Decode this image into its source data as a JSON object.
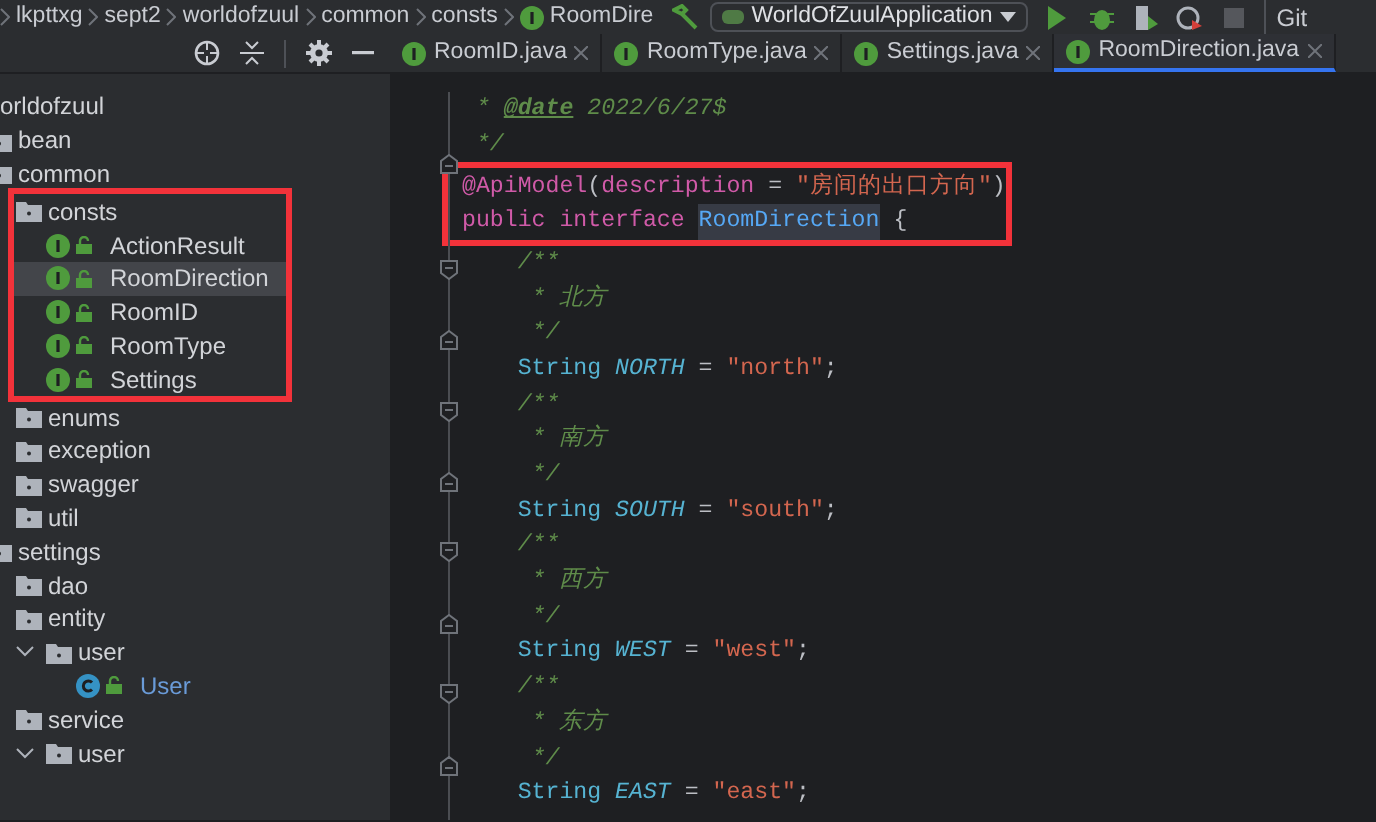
{
  "breadcrumbs": [
    {
      "label": "lkpttxg",
      "kind": "folder"
    },
    {
      "label": "sept2",
      "kind": "folder"
    },
    {
      "label": "worldofzuul",
      "kind": "folder"
    },
    {
      "label": "common",
      "kind": "folder"
    },
    {
      "label": "consts",
      "kind": "folder"
    },
    {
      "label": "RoomDire",
      "kind": "interface"
    }
  ],
  "run_config": {
    "label": "WorldOfZuulApplication"
  },
  "vcs_label": "Git",
  "tabs": [
    {
      "label": "RoomID.java",
      "selected": false
    },
    {
      "label": "RoomType.java",
      "selected": false
    },
    {
      "label": "Settings.java",
      "selected": false
    },
    {
      "label": "RoomDirection.java",
      "selected": true
    }
  ],
  "project_tree": [
    {
      "label": "orldofzuul",
      "children": [
        {
          "label": "bean",
          "kind": "folder"
        },
        {
          "label": "common",
          "kind": "folder",
          "children": [
            {
              "label": "consts",
              "kind": "folder",
              "boxed": true,
              "children": [
                {
                  "label": "ActionResult",
                  "kind": "interface",
                  "selected": false,
                  "modified": false
                },
                {
                  "label": "RoomDirection",
                  "kind": "interface",
                  "selected": true,
                  "modified": false
                },
                {
                  "label": "RoomID",
                  "kind": "interface",
                  "selected": false,
                  "modified": false
                },
                {
                  "label": "RoomType",
                  "kind": "interface",
                  "selected": false,
                  "modified": false
                },
                {
                  "label": "Settings",
                  "kind": "interface",
                  "selected": false,
                  "modified": false
                }
              ]
            },
            {
              "label": "enums",
              "kind": "folder"
            },
            {
              "label": "exception",
              "kind": "folder"
            },
            {
              "label": "swagger",
              "kind": "folder"
            },
            {
              "label": "util",
              "kind": "folder"
            }
          ]
        },
        {
          "label": "settings",
          "kind": "folder",
          "children": [
            {
              "label": "dao",
              "kind": "folder"
            },
            {
              "label": "entity",
              "kind": "folder",
              "children": [
                {
                  "label": "user",
                  "kind": "folder",
                  "expanded": true,
                  "children": [
                    {
                      "label": "User",
                      "kind": "class",
                      "selected": false,
                      "modified": true
                    }
                  ]
                }
              ]
            },
            {
              "label": "service",
              "kind": "folder",
              "children": [
                {
                  "label": "user",
                  "kind": "folder",
                  "expanded": true
                }
              ]
            }
          ]
        }
      ]
    }
  ],
  "code_lines": [
    {
      "nested": false,
      "fold_start": false,
      "fold_end": false,
      "boxed": false,
      "tokens": [
        {
          "kind": "comment",
          "text": " * "
        },
        {
          "kind": "doc-tag",
          "text": "@date"
        },
        {
          "kind": "comment",
          "text": " 2022/6/27$"
        }
      ]
    },
    {
      "nested": false,
      "fold_start": false,
      "fold_end": true,
      "boxed": false,
      "tokens": [
        {
          "kind": "comment",
          "text": " */"
        }
      ]
    },
    {
      "nested": false,
      "fold_start": false,
      "fold_end": false,
      "boxed": true,
      "tokens": [
        {
          "kind": "annotation",
          "text": "@ApiModel"
        },
        {
          "kind": "plain",
          "text": "("
        },
        {
          "kind": "annotation",
          "text": "description"
        },
        {
          "kind": "plain",
          "text": " = "
        },
        {
          "kind": "string",
          "text": "\"房间的出口方向\""
        },
        {
          "kind": "plain",
          "text": ")"
        }
      ]
    },
    {
      "nested": false,
      "fold_start": false,
      "fold_end": false,
      "boxed": true,
      "tokens": [
        {
          "kind": "keyword",
          "text": "public interface "
        },
        {
          "kind": "declaration",
          "text": "RoomDirection"
        },
        {
          "kind": "plain",
          "text": " {"
        }
      ]
    },
    {
      "nested": true,
      "fold_start": true,
      "fold_end": false,
      "boxed": false,
      "tokens": [
        {
          "kind": "comment",
          "text": "/**"
        }
      ]
    },
    {
      "nested": true,
      "fold_start": false,
      "fold_end": false,
      "boxed": false,
      "tokens": [
        {
          "kind": "comment",
          "text": " * 北方"
        }
      ]
    },
    {
      "nested": true,
      "fold_start": false,
      "fold_end": true,
      "boxed": false,
      "tokens": [
        {
          "kind": "comment",
          "text": " */"
        }
      ]
    },
    {
      "nested": true,
      "fold_start": false,
      "fold_end": false,
      "boxed": false,
      "tokens": [
        {
          "kind": "type",
          "text": "String "
        },
        {
          "kind": "constant",
          "text": "NORTH"
        },
        {
          "kind": "plain",
          "text": " = "
        },
        {
          "kind": "string",
          "text": "\"north\""
        },
        {
          "kind": "plain",
          "text": ";"
        }
      ]
    },
    {
      "nested": true,
      "fold_start": true,
      "fold_end": false,
      "boxed": false,
      "tokens": [
        {
          "kind": "comment",
          "text": "/**"
        }
      ]
    },
    {
      "nested": true,
      "fold_start": false,
      "fold_end": false,
      "boxed": false,
      "tokens": [
        {
          "kind": "comment",
          "text": " * 南方"
        }
      ]
    },
    {
      "nested": true,
      "fold_start": false,
      "fold_end": true,
      "boxed": false,
      "tokens": [
        {
          "kind": "comment",
          "text": " */"
        }
      ]
    },
    {
      "nested": true,
      "fold_start": false,
      "fold_end": false,
      "boxed": false,
      "tokens": [
        {
          "kind": "type",
          "text": "String "
        },
        {
          "kind": "constant",
          "text": "SOUTH"
        },
        {
          "kind": "plain",
          "text": " = "
        },
        {
          "kind": "string",
          "text": "\"south\""
        },
        {
          "kind": "plain",
          "text": ";"
        }
      ]
    },
    {
      "nested": true,
      "fold_start": true,
      "fold_end": false,
      "boxed": false,
      "tokens": [
        {
          "kind": "comment",
          "text": "/**"
        }
      ]
    },
    {
      "nested": true,
      "fold_start": false,
      "fold_end": false,
      "boxed": false,
      "tokens": [
        {
          "kind": "comment",
          "text": " * 西方"
        }
      ]
    },
    {
      "nested": true,
      "fold_start": false,
      "fold_end": true,
      "boxed": false,
      "tokens": [
        {
          "kind": "comment",
          "text": " */"
        }
      ]
    },
    {
      "nested": true,
      "fold_start": false,
      "fold_end": false,
      "boxed": false,
      "tokens": [
        {
          "kind": "type",
          "text": "String "
        },
        {
          "kind": "constant",
          "text": "WEST"
        },
        {
          "kind": "plain",
          "text": " = "
        },
        {
          "kind": "string",
          "text": "\"west\""
        },
        {
          "kind": "plain",
          "text": ";"
        }
      ]
    },
    {
      "nested": true,
      "fold_start": true,
      "fold_end": false,
      "boxed": false,
      "tokens": [
        {
          "kind": "comment",
          "text": "/**"
        }
      ]
    },
    {
      "nested": true,
      "fold_start": false,
      "fold_end": false,
      "boxed": false,
      "tokens": [
        {
          "kind": "comment",
          "text": " * 东方"
        }
      ]
    },
    {
      "nested": true,
      "fold_start": false,
      "fold_end": true,
      "boxed": false,
      "tokens": [
        {
          "kind": "comment",
          "text": " */"
        }
      ]
    },
    {
      "nested": true,
      "fold_start": false,
      "fold_end": false,
      "boxed": false,
      "tokens": [
        {
          "kind": "type",
          "text": "String "
        },
        {
          "kind": "constant",
          "text": "EAST"
        },
        {
          "kind": "plain",
          "text": " = "
        },
        {
          "kind": "string",
          "text": "\"east\""
        },
        {
          "kind": "plain",
          "text": ";"
        }
      ]
    }
  ]
}
